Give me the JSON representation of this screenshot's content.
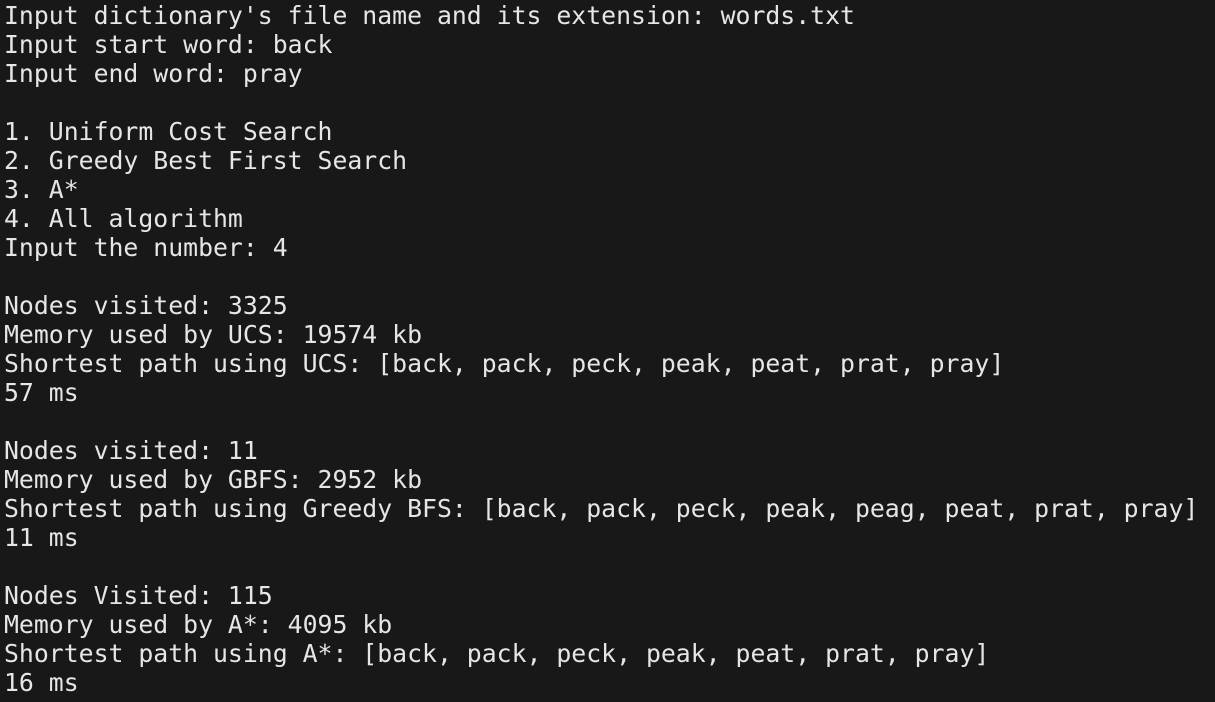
{
  "terminal": {
    "background_color": "#181818",
    "text_color": "#e6e6e6",
    "lines": [
      "Input dictionary's file name and its extension: words.txt",
      "Input start word: back",
      "Input end word: pray",
      "",
      "1. Uniform Cost Search",
      "2. Greedy Best First Search",
      "3. A*",
      "4. All algorithm",
      "Input the number: 4",
      "",
      "Nodes visited: 3325",
      "Memory used by UCS: 19574 kb",
      "Shortest path using UCS: [back, pack, peck, peak, peat, prat, pray]",
      "57 ms",
      "",
      "Nodes visited: 11",
      "Memory used by GBFS: 2952 kb",
      "Shortest path using Greedy BFS: [back, pack, peck, peak, peag, peat, prat, pray]",
      "11 ms",
      "",
      "Nodes Visited: 115",
      "Memory used by A*: 4095 kb",
      "Shortest path using A*: [back, pack, peck, peak, peat, prat, pray]",
      "16 ms"
    ]
  }
}
